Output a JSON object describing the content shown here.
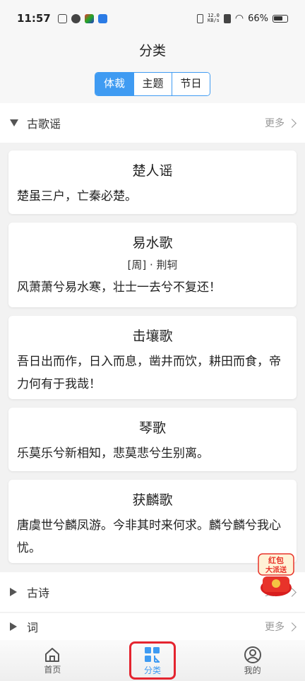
{
  "status": {
    "time": "11:57",
    "speed_top": "12.0",
    "speed_bottom": "KB/s",
    "battery": "66%"
  },
  "header": {
    "title": "分类"
  },
  "segments": [
    {
      "label": "体裁",
      "active": true
    },
    {
      "label": "主题",
      "active": false
    },
    {
      "label": "节日",
      "active": false
    }
  ],
  "sections": [
    {
      "title": "古歌谣",
      "more": "更多",
      "expanded": true
    },
    {
      "title": "古诗",
      "more": "更多",
      "expanded": false
    },
    {
      "title": "词",
      "more": "更多",
      "expanded": false
    }
  ],
  "poems": [
    {
      "title": "楚人谣",
      "author": "",
      "text": "楚虽三户，亡秦必楚。"
    },
    {
      "title": "易水歌",
      "author": "[周] · 荆轲",
      "text": "风萧萧兮易水寒，壮士一去兮不复还！"
    },
    {
      "title": "击壤歌",
      "author": "",
      "text": "吾日出而作，日入而息，凿井而饮，耕田而食，帝力何有于我哉！"
    },
    {
      "title": "琴歌",
      "author": "",
      "text": "乐莫乐兮新相知，悲莫悲兮生别离。"
    },
    {
      "title": "获麟歌",
      "author": "",
      "text": "唐虞世兮麟凤游。今非其时来何求。麟兮麟兮我心忧。"
    }
  ],
  "redpacket": {
    "line1": "红包",
    "line2": "大派送"
  },
  "nav": [
    {
      "label": "首页",
      "icon": "home-icon"
    },
    {
      "label": "分类",
      "icon": "category-icon",
      "active": true
    },
    {
      "label": "我的",
      "icon": "profile-icon"
    }
  ],
  "colors": {
    "accent": "#3f9bf2",
    "highlight": "#e4242f"
  }
}
